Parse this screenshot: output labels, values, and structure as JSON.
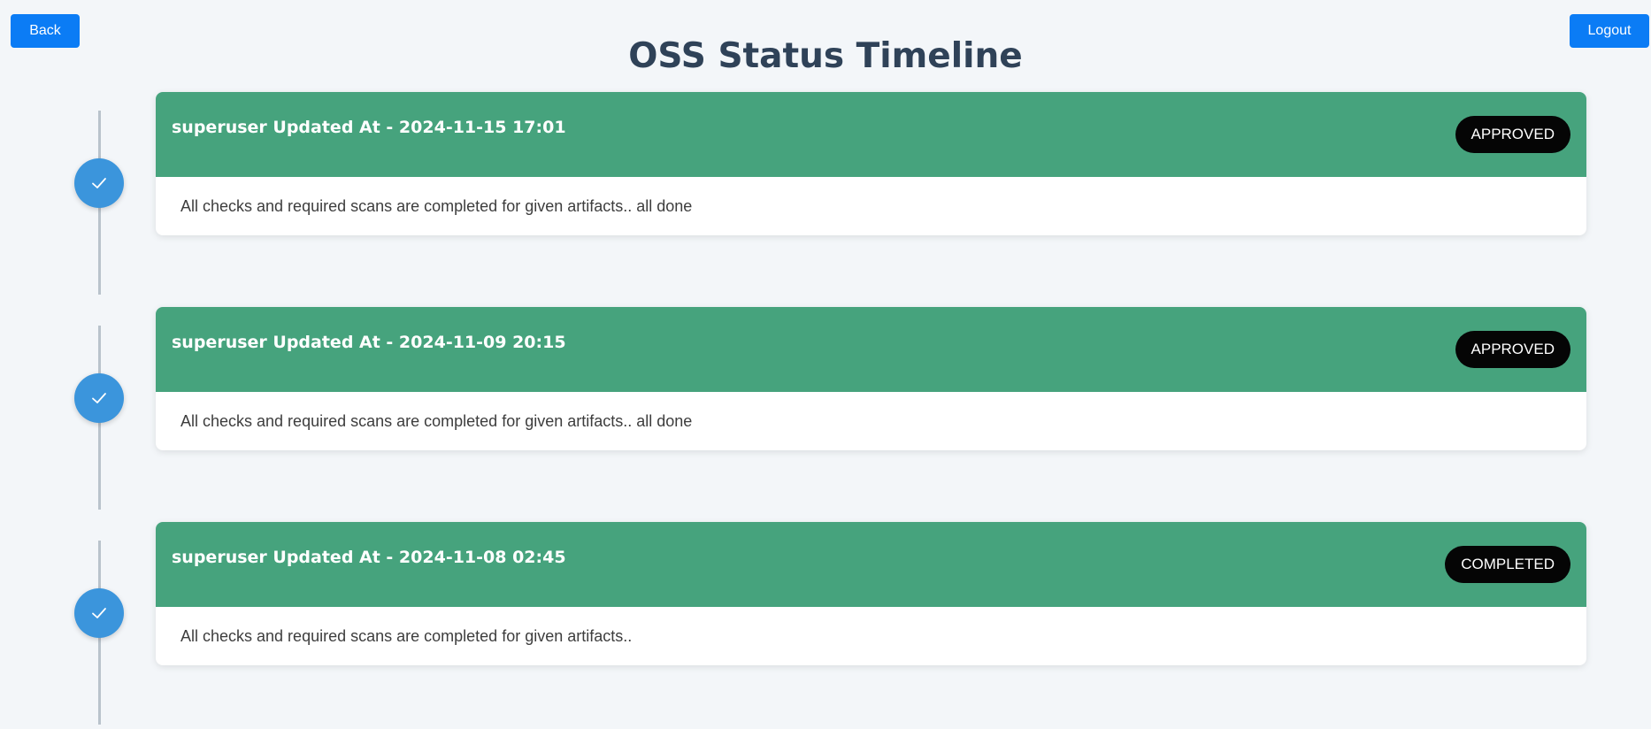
{
  "header": {
    "title": "OSS Status Timeline",
    "back_label": "Back",
    "logout_label": "Logout"
  },
  "colors": {
    "page_background": "#f3f6f9",
    "button_blue": "#0b7cf5",
    "title_color": "#2f4258",
    "card_header_green": "#46a37d",
    "badge_black": "#050505",
    "timeline_dot_blue": "#3b95dc",
    "timeline_line_gray": "#b9c3cc"
  },
  "timeline": [
    {
      "icon": "check-icon",
      "heading": "superuser Updated At - 2024-11-15 17:01",
      "status": "APPROVED",
      "message": "All checks and required scans are completed for given artifacts.. all done"
    },
    {
      "icon": "check-icon",
      "heading": "superuser Updated At - 2024-11-09 20:15",
      "status": "APPROVED",
      "message": "All checks and required scans are completed for given artifacts.. all done"
    },
    {
      "icon": "check-icon",
      "heading": "superuser Updated At - 2024-11-08 02:45",
      "status": "COMPLETED",
      "message": "All checks and required scans are completed for given artifacts.."
    }
  ]
}
